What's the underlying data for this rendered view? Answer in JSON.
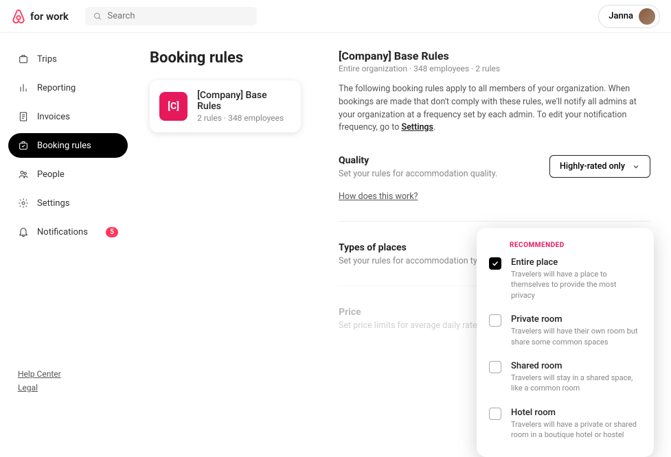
{
  "brand": {
    "name": "for work"
  },
  "search": {
    "placeholder": "Search"
  },
  "user": {
    "name": "Janna"
  },
  "nav": {
    "trips": "Trips",
    "reporting": "Reporting",
    "invoices": "Invoices",
    "bookingRules": "Booking rules",
    "people": "People",
    "settings": "Settings",
    "notifications": "Notifications",
    "notifBadge": "5"
  },
  "footer": {
    "help": "Help Center",
    "legal": "Legal"
  },
  "leftPanel": {
    "title": "Booking rules",
    "card": {
      "avatar": "[C]",
      "title": "[Company] Base Rules",
      "meta": "2 rules · 348 employees"
    }
  },
  "detail": {
    "title": "[Company] Base Rules",
    "sub": "Entire organization · 348 employees · 2 rules",
    "descPrefix": "The following booking rules apply to all members of your organization. When bookings are made that don't comply with these rules, we'll notify all admins at your organization at a frequency set by each admin. To edit your notification frequency, go to ",
    "descLink": "Settings",
    "descSuffix": "."
  },
  "quality": {
    "title": "Quality",
    "desc": "Set your rules for accommodation quality.",
    "link": "How does this work?",
    "value": "Highly-rated only"
  },
  "types": {
    "title": "Types of places",
    "desc": "Set your rules for accommodation type.",
    "value": "Entire place",
    "rec": "RECOMMENDED",
    "options": [
      {
        "id": "entire",
        "title": "Entire place",
        "desc": "Travelers will have a place to themselves to provide the most privacy",
        "checked": true
      },
      {
        "id": "private",
        "title": "Private room",
        "desc": "Travelers will have their own room but share some common spaces",
        "checked": false
      },
      {
        "id": "shared",
        "title": "Shared room",
        "desc": "Travelers will stay in a shared space, like a common room",
        "checked": false
      },
      {
        "id": "hotel",
        "title": "Hotel room",
        "desc": "Travelers will have a private or shared room in a boutique hotel or hostel",
        "checked": false
      }
    ]
  },
  "price": {
    "title": "Price",
    "desc": "Set price limits for average daily rate per p"
  }
}
